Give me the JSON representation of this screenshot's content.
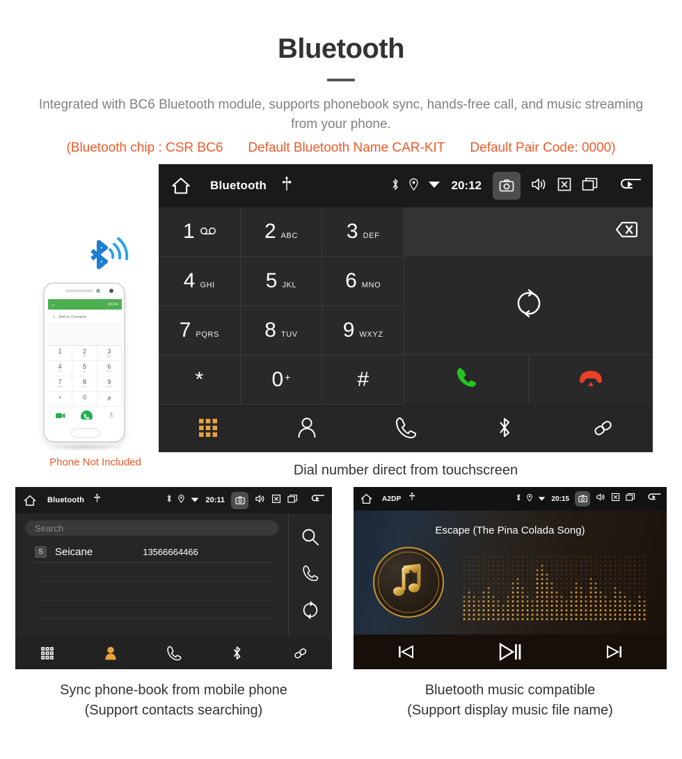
{
  "header": {
    "title": "Bluetooth",
    "subtitle": "Integrated with BC6 Bluetooth module, supports phonebook sync, hands-free call, and music streaming from your phone.",
    "specs": [
      "(Bluetooth chip : CSR BC6",
      "Default Bluetooth Name CAR-KIT",
      "Default Pair Code: 0000)"
    ],
    "accent_color": "#ef5a28",
    "title_color": "#333333"
  },
  "dialer": {
    "statusbar": {
      "title": "Bluetooth",
      "time": "20:12",
      "icons": [
        "home-icon",
        "usb-icon",
        "bluetooth-icon",
        "location-icon",
        "wifi-icon",
        "camera-icon",
        "volume-icon",
        "mute-icon",
        "recents-icon",
        "back-icon"
      ]
    },
    "keys": [
      {
        "digit": "1",
        "sub": "",
        "voicemail": true
      },
      {
        "digit": "2",
        "sub": "ABC"
      },
      {
        "digit": "3",
        "sub": "DEF"
      },
      {
        "digit": "4",
        "sub": "GHI"
      },
      {
        "digit": "5",
        "sub": "JKL"
      },
      {
        "digit": "6",
        "sub": "MNO"
      },
      {
        "digit": "7",
        "sub": "PQRS"
      },
      {
        "digit": "8",
        "sub": "TUV"
      },
      {
        "digit": "9",
        "sub": "WXYZ"
      },
      {
        "digit": "*",
        "sub": ""
      },
      {
        "digit": "0",
        "sub": "",
        "plus": "+"
      },
      {
        "digit": "#",
        "sub": ""
      }
    ],
    "number_value": "",
    "backspace_icon": "backspace-icon",
    "sync_icon": "sync-icon",
    "call_icon": "call-accept-icon",
    "hangup_icon": "call-end-icon",
    "call_color": "#22c522",
    "hangup_color": "#e8402a",
    "tabs": [
      {
        "name": "keypad",
        "icon": "keypad-icon",
        "active": true
      },
      {
        "name": "contacts",
        "icon": "contact-icon",
        "active": false
      },
      {
        "name": "call-log",
        "icon": "phone-icon",
        "active": false
      },
      {
        "name": "bluetooth",
        "icon": "bluetooth-icon",
        "active": false
      },
      {
        "name": "link",
        "icon": "link-icon",
        "active": false
      }
    ],
    "active_tab_color": "#e8a33d",
    "caption": "Dial number direct from touchscreen"
  },
  "phone_illustration": {
    "screen": {
      "back_icon": "back-arrow-icon",
      "more_label": "MORE",
      "add_label": "Add to Contacts",
      "keys": [
        {
          "d": "1",
          "s": "∞"
        },
        {
          "d": "2",
          "s": "ABC"
        },
        {
          "d": "3",
          "s": "DEF"
        },
        {
          "d": "4",
          "s": "GHI"
        },
        {
          "d": "5",
          "s": "JKL"
        },
        {
          "d": "6",
          "s": "MNO"
        },
        {
          "d": "7",
          "s": "PQRS"
        },
        {
          "d": "8",
          "s": "TUV"
        },
        {
          "d": "9",
          "s": "WXYZ"
        },
        {
          "d": "*",
          "s": ""
        },
        {
          "d": "0",
          "s": "+"
        },
        {
          "d": "#",
          "s": ""
        }
      ],
      "header_color": "#4caf50",
      "call_color": "#22b14c"
    },
    "bluetooth_wave_color": "#1e9ae0",
    "note": "Phone Not Included"
  },
  "phonebook": {
    "statusbar": {
      "title": "Bluetooth",
      "time": "20:11"
    },
    "search_placeholder": "Search",
    "contacts": [
      {
        "initial": "S",
        "name": "Seicane",
        "number": "13566664466"
      }
    ],
    "side_icons": [
      "search-icon",
      "phone-icon",
      "sync-icon"
    ],
    "tabs": [
      {
        "name": "keypad",
        "icon": "keypad-icon",
        "active": false
      },
      {
        "name": "contacts",
        "icon": "contact-icon",
        "active": true
      },
      {
        "name": "call-log",
        "icon": "phone-icon",
        "active": false
      },
      {
        "name": "bluetooth",
        "icon": "bluetooth-icon",
        "active": false
      },
      {
        "name": "link",
        "icon": "link-icon",
        "active": false
      }
    ],
    "caption_line1": "Sync phone-book from mobile phone",
    "caption_line2": "(Support contacts searching)"
  },
  "music": {
    "statusbar": {
      "title": "A2DP",
      "time": "20:15"
    },
    "track_title": "Escape (The Pina Colada Song)",
    "controls": [
      "previous-icon",
      "play-pause-icon",
      "next-icon"
    ],
    "accent_color": "#c8952f",
    "caption_line1": "Bluetooth music compatible",
    "caption_line2": "(Support display music file name)"
  }
}
